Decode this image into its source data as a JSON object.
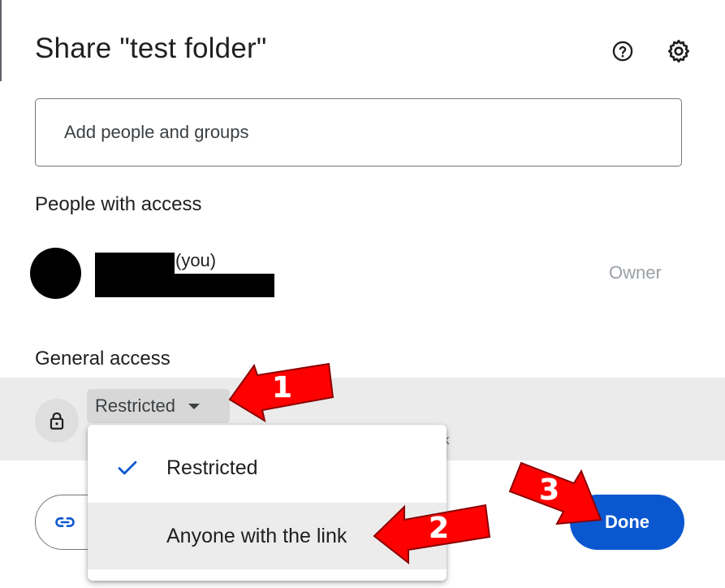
{
  "dialog": {
    "title": "Share \"test folder\"",
    "icons": {
      "help": "help-circle-icon",
      "settings": "gear-icon"
    }
  },
  "add_people": {
    "placeholder": "Add people and groups"
  },
  "people_with_access": {
    "heading": "People with access",
    "owner": {
      "suffix": "(you)",
      "role": "Owner"
    }
  },
  "general_access": {
    "heading": "General access",
    "selected": "Restricted",
    "description_visible_fragment": "k"
  },
  "dropdown": {
    "options": [
      {
        "label": "Restricted",
        "checked": true
      },
      {
        "label": "Anyone with the link",
        "checked": false,
        "hovered": true
      }
    ]
  },
  "footer": {
    "copy_link_icon": "link-icon",
    "done_label": "Done"
  },
  "annotations": [
    "1",
    "2",
    "3"
  ],
  "colors": {
    "primary": "#0b57d0",
    "check": "#0b57d0",
    "annotation_arrow": "#ff0000",
    "band": "#ebebeb"
  }
}
